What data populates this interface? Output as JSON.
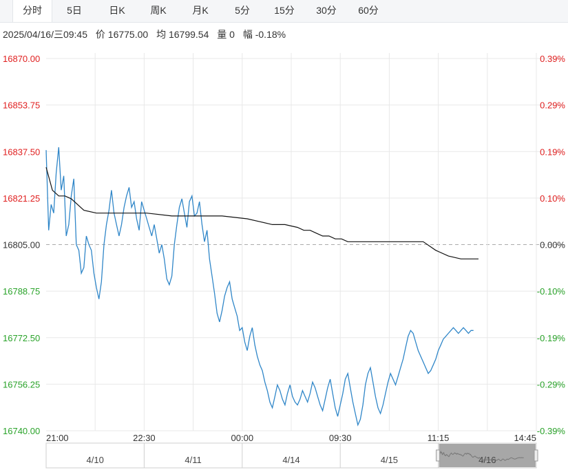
{
  "tabs": [
    {
      "label": "分时",
      "active": true
    },
    {
      "label": "5日"
    },
    {
      "label": "日K"
    },
    {
      "label": "周K"
    },
    {
      "label": "月K"
    },
    {
      "label": "5分"
    },
    {
      "label": "15分"
    },
    {
      "label": "30分"
    },
    {
      "label": "60分"
    }
  ],
  "info": {
    "datetime": "2025/04/16/三09:45",
    "price": "价 16775.00",
    "avg": "均 16799.54",
    "volume": "量 0",
    "change": "幅 -0.18%"
  },
  "colors": {
    "up": "#e02020",
    "down": "#2aa32a",
    "price_line": "#2f86c8",
    "avg_line": "#111111",
    "grid": "#e8e8e8",
    "baseline": "#aaaaaa"
  },
  "chart_data": {
    "type": "line",
    "title": "",
    "prev_close": 16805.0,
    "ylim": [
      16740.0,
      16870.0
    ],
    "y_ticks_left": [
      "16870.00",
      "16853.75",
      "16837.50",
      "16821.25",
      "16805.00",
      "16788.75",
      "16772.50",
      "16756.25",
      "16740.00"
    ],
    "y_ticks_right": [
      "0.39%",
      "0.29%",
      "0.19%",
      "0.10%",
      "0.00%",
      "-0.10%",
      "-0.19%",
      "-0.29%",
      "-0.39%"
    ],
    "x_ticks": [
      "21:00",
      "22:30",
      "00:00",
      "09:30",
      "11:15",
      "14:45"
    ],
    "session_minutes_total": 390,
    "series": [
      {
        "key": "price",
        "minute": [
          0,
          2,
          4,
          6,
          8,
          10,
          12,
          14,
          16,
          18,
          20,
          22,
          24,
          26,
          28,
          30,
          32,
          34,
          36,
          38,
          40,
          42,
          44,
          46,
          48,
          50,
          52,
          54,
          56,
          58,
          60,
          62,
          64,
          66,
          68,
          70,
          72,
          74,
          76,
          78,
          80,
          82,
          84,
          86,
          88,
          90,
          92,
          94,
          96,
          98,
          100,
          102,
          104,
          106,
          108,
          110,
          112,
          114,
          116,
          118,
          120,
          122,
          124,
          126,
          128,
          130,
          132,
          134,
          136,
          138,
          140,
          142,
          144,
          146,
          148,
          150,
          152,
          154,
          156,
          158,
          160,
          162,
          164,
          166,
          168,
          170,
          172,
          174,
          176,
          178,
          180,
          182,
          184,
          186,
          188,
          190,
          192,
          194,
          196,
          198,
          200,
          202,
          204,
          206,
          208,
          210,
          212,
          214,
          216,
          218,
          220,
          222,
          224,
          226,
          228,
          230,
          232,
          234,
          236,
          238,
          240,
          242,
          244,
          246,
          248,
          250,
          252,
          254,
          256,
          258,
          260,
          262,
          264,
          266,
          268,
          270,
          272,
          274,
          276,
          278,
          280,
          282,
          284,
          286,
          288,
          290,
          292,
          294,
          296,
          298,
          300,
          302,
          304,
          306,
          308,
          310,
          312,
          314,
          316,
          318,
          320,
          322,
          324,
          326,
          328,
          330,
          332,
          334,
          336,
          338,
          340,
          342,
          344
        ],
        "values": [
          16838,
          16810,
          16819,
          16816,
          16830,
          16839,
          16824,
          16829,
          16808,
          16812,
          16822,
          16828,
          16805,
          16803,
          16795,
          16797,
          16808,
          16805,
          16803,
          16795,
          16790,
          16786,
          16792,
          16805,
          16812,
          16817,
          16824,
          16816,
          16812,
          16808,
          16812,
          16818,
          16822,
          16825,
          16818,
          16820,
          16814,
          16810,
          16820,
          16817,
          16814,
          16811,
          16808,
          16812,
          16807,
          16802,
          16805,
          16800,
          16793,
          16791,
          16794,
          16805,
          16812,
          16818,
          16821,
          16816,
          16811,
          16820,
          16822,
          16815,
          16816,
          16820,
          16812,
          16806,
          16810,
          16800,
          16794,
          16788,
          16781,
          16778,
          16782,
          16787,
          16790,
          16792,
          16786,
          16783,
          16780,
          16775,
          16776,
          16771,
          16768,
          16773,
          16776,
          16770,
          16766,
          16763,
          16761,
          16757,
          16754,
          16750,
          16748,
          16752,
          16756,
          16754,
          16751,
          16749,
          16753,
          16756,
          16752,
          16750,
          16749,
          16751,
          16754,
          16752,
          16750,
          16753,
          16757,
          16755,
          16752,
          16749,
          16747,
          16751,
          16755,
          16758,
          16753,
          16748,
          16745,
          16749,
          16753,
          16758,
          16760,
          16755,
          16750,
          16746,
          16742,
          16744,
          16749,
          16756,
          16760,
          16762,
          16757,
          16752,
          16748,
          16746,
          16749,
          16753,
          16757,
          16760,
          16758,
          16756,
          16759,
          16762,
          16765,
          16769,
          16773,
          16775,
          16774,
          16771,
          16768,
          16766,
          16764,
          16762,
          16760,
          16761,
          16763,
          16765,
          16768,
          16770,
          16772,
          16773,
          16774,
          16775,
          16776,
          16775,
          16774,
          16775,
          16776,
          16775,
          16774,
          16775,
          16775
        ]
      },
      {
        "key": "average",
        "minute": [
          0,
          5,
          10,
          15,
          20,
          25,
          30,
          40,
          60,
          80,
          100,
          120,
          140,
          160,
          170,
          180,
          190,
          200,
          205,
          210,
          215,
          220,
          225,
          230,
          235,
          240,
          250,
          260,
          270,
          280,
          290,
          300,
          310,
          320,
          330,
          340,
          344
        ],
        "values": [
          16832,
          16824,
          16822,
          16822,
          16821,
          16819,
          16817,
          16816,
          16816,
          16816,
          16815,
          16815,
          16815,
          16814,
          16813,
          16812,
          16812,
          16811,
          16810,
          16810,
          16809,
          16808,
          16808,
          16807,
          16807,
          16806,
          16806,
          16806,
          16806,
          16806,
          16806,
          16806,
          16803,
          16801,
          16800,
          16800,
          16800
        ]
      }
    ],
    "navigator": {
      "dates": [
        "4/10",
        "4/11",
        "4/14",
        "4/15",
        "4/16"
      ],
      "selected_index": 4
    }
  }
}
